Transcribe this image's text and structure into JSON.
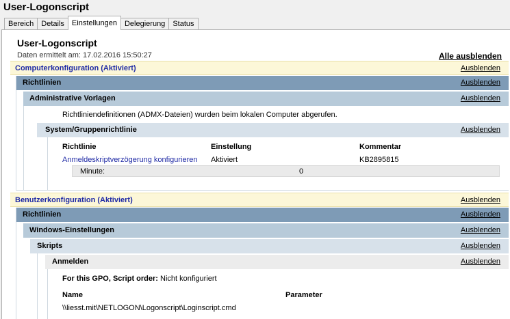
{
  "window": {
    "title": "User-Logonscript"
  },
  "tabs": [
    "Bereich",
    "Details",
    "Einstellungen",
    "Delegierung",
    "Status"
  ],
  "active_tab": "Einstellungen",
  "report": {
    "title": "User-Logonscript",
    "date_line": "Daten ermittelt am: 17.02.2016 15:50:27",
    "hide_all": "Alle ausblenden"
  },
  "hide_label": "Ausblenden",
  "computer": {
    "header": "Computerkonfiguration (Aktiviert)",
    "richtlinien": "Richtlinien",
    "admin_templates": "Administrative Vorlagen",
    "admx_note": "Richtliniendefinitionen (ADMX-Dateien) wurden beim lokalen Computer abgerufen.",
    "group_policy": "System/Gruppenrichtlinie",
    "table": {
      "headers": [
        "Richtlinie",
        "Einstellung",
        "Kommentar"
      ],
      "row": {
        "policy": "Anmeldeskriptverzögerung konfigurieren",
        "setting": "Aktiviert",
        "comment": "KB2895815"
      },
      "sub": {
        "label": "Minute:",
        "value": "0"
      }
    }
  },
  "user": {
    "header": "Benutzerkonfiguration (Aktiviert)",
    "richtlinien": "Richtlinien",
    "windows_settings": "Windows-Einstellungen",
    "scripts": "Skripts",
    "logon": "Anmelden",
    "script_order_label": "For this GPO, Script order:",
    "script_order_value": "Nicht konfiguriert",
    "table": {
      "headers": [
        "Name",
        "Parameter"
      ],
      "row": {
        "name": "\\\\liesst.mit\\NETLOGON\\Logonscript\\Loginscript.cmd",
        "parameter": ""
      }
    }
  }
}
